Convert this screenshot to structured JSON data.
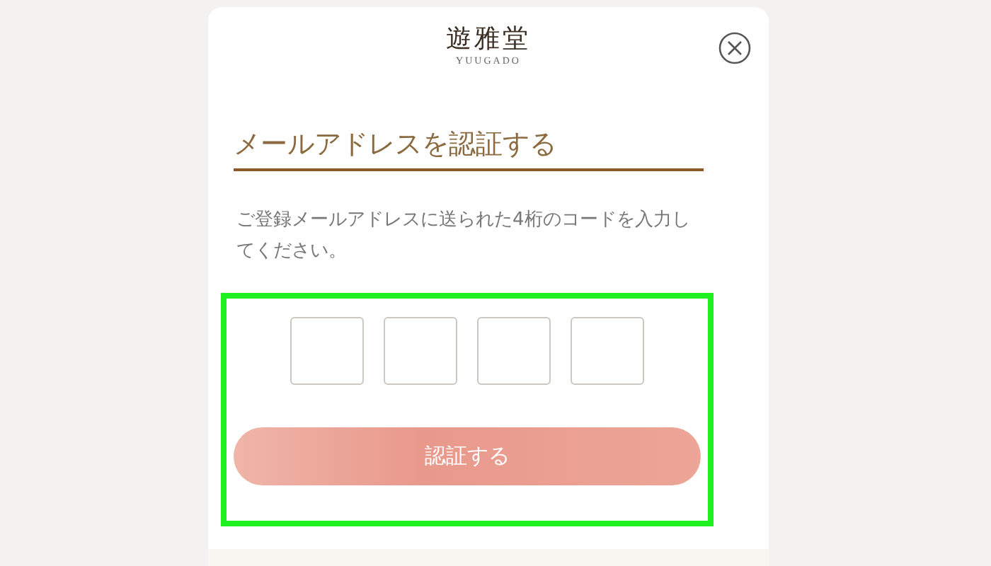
{
  "logo": {
    "name": "遊雅堂",
    "subtitle": "YUUGADO"
  },
  "title": "メールアドレスを認証する",
  "description": "ご登録メールアドレスに送られた4桁のコードを入力してください。",
  "code_inputs": [
    {
      "filled": false
    },
    {
      "filled": false
    },
    {
      "filled": false
    },
    {
      "filled": false
    }
  ],
  "verify_button": "認証する"
}
